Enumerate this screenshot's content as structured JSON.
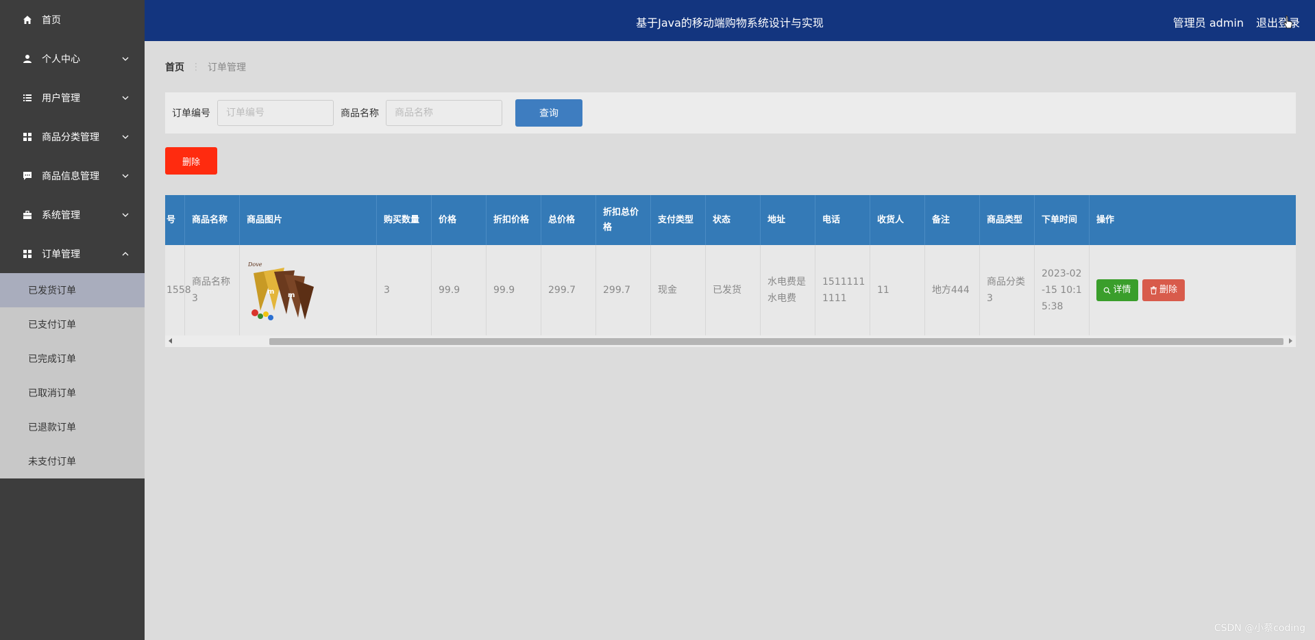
{
  "header": {
    "title": "基于Java的移动端购物系统设计与实现",
    "user": "管理员 admin",
    "logout": "退出登录"
  },
  "sidebar": {
    "items": [
      {
        "label": "首页",
        "icon": "home-icon"
      },
      {
        "label": "个人中心",
        "icon": "user-icon"
      },
      {
        "label": "用户管理",
        "icon": "list-icon"
      },
      {
        "label": "商品分类管理",
        "icon": "grid-icon"
      },
      {
        "label": "商品信息管理",
        "icon": "chat-icon"
      },
      {
        "label": "系统管理",
        "icon": "briefcase-icon"
      },
      {
        "label": "订单管理",
        "icon": "grid-icon"
      }
    ],
    "submenu": [
      "已发货订单",
      "已支付订单",
      "已完成订单",
      "已取消订单",
      "已退款订单",
      "未支付订单"
    ]
  },
  "breadcrumb": {
    "home": "首页",
    "sep": "⋮",
    "current": "订单管理"
  },
  "search": {
    "order_label": "订单编号",
    "order_placeholder": "订单编号",
    "product_label": "商品名称",
    "product_placeholder": "商品名称",
    "query_button": "查询"
  },
  "delete_button": "删除",
  "table": {
    "headers": [
      "号",
      "商品名称",
      "商品图片",
      "购买数量",
      "价格",
      "折扣价格",
      "总价格",
      "折扣总价格",
      "支付类型",
      "状态",
      "地址",
      "电话",
      "收货人",
      "备注",
      "商品类型",
      "下单时间",
      "操作"
    ],
    "row": {
      "order_no": "1558",
      "product_name": "商品名称3",
      "quantity": "3",
      "price": "99.9",
      "discount_price": "99.9",
      "total_price": "299.7",
      "discount_total": "299.7",
      "pay_type": "现金",
      "status": "已发货",
      "address": "水电费是水电费",
      "phone": "15111111111",
      "receiver": "11",
      "remark": "地方444",
      "product_type": "商品分类3",
      "order_time": "2023-02-15 10:15:38",
      "detail_button": "详情",
      "delete_button": "删除"
    }
  },
  "watermark": "CSDN @小蔡coding",
  "colors": {
    "header": "#13357f",
    "sidebar": "#3d3d3d",
    "table_header": "#347ab7",
    "query_button": "#3e7dc0",
    "delete_button": "#ff2b0f",
    "detail_button": "#3a9e2b",
    "row_delete_button": "#d85b4b"
  }
}
